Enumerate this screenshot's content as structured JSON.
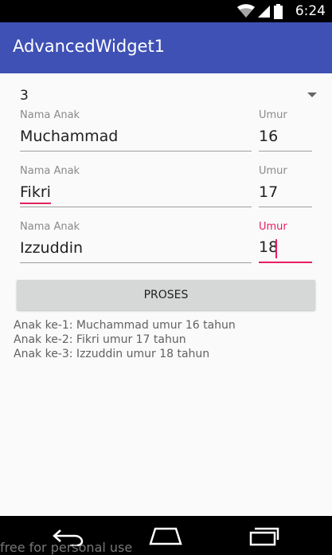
{
  "status_bar": {
    "time": "6:24"
  },
  "app_bar": {
    "title": "AdvancedWidget1"
  },
  "spinner": {
    "selected": "3"
  },
  "rows": [
    {
      "name_label": "Nama Anak",
      "name_value": "Muchammad",
      "age_label": "Umur",
      "age_value": "16"
    },
    {
      "name_label": "Nama Anak",
      "name_value": "Fikri",
      "age_label": "Umur",
      "age_value": "17"
    },
    {
      "name_label": "Nama Anak",
      "name_value": "Izzuddin",
      "age_label": "Umur",
      "age_value": "18"
    }
  ],
  "button": {
    "label": "PROSES"
  },
  "results": [
    "Anak ke-1: Muchammad umur 16 tahun",
    "Anak ke-2: Fikri umur 17 tahun",
    "Anak ke-3: Izzuddin umur 18 tahun"
  ],
  "watermark": "free for personal use",
  "colors": {
    "primary": "#3F51B5",
    "accent": "#E91E63",
    "button": "#D6D7D7"
  },
  "icons": [
    "wifi-icon",
    "signal-icon",
    "battery-icon",
    "back-icon",
    "home-icon",
    "recents-icon",
    "dropdown-arrow-icon"
  ]
}
